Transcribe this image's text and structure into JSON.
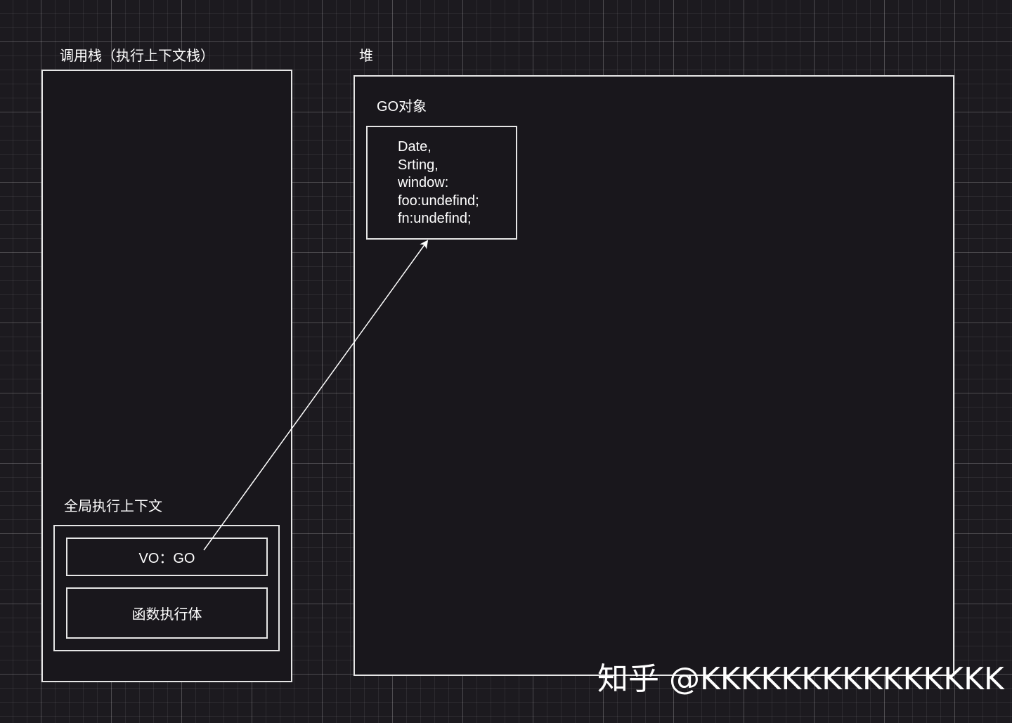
{
  "call_stack": {
    "title": "调用栈（执行上下文栈）",
    "global_context": {
      "title": "全局执行上下文",
      "vo_label": "VO：GO",
      "body_label": "函数执行体"
    }
  },
  "heap": {
    "title": "堆",
    "go_object": {
      "title": "GO对象",
      "lines": [
        "Date,",
        "Srting,",
        "window:",
        "foo:undefind;",
        "fn:undefind;"
      ]
    }
  },
  "watermark": "知乎 @KKKKKKKKKKKKKKK",
  "colors": {
    "background": "#1c1a1f",
    "box_fill": "#19171c",
    "stroke": "#e6e6e6",
    "text": "#ffffff"
  }
}
